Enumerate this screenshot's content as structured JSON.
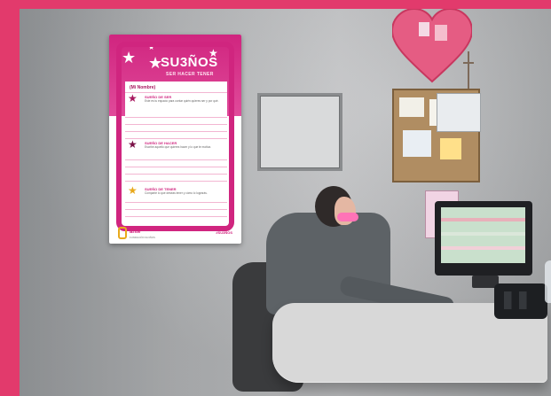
{
  "poster": {
    "title": "SU3ÑOS",
    "subtitle": "SER HACER TENER",
    "label": "(Mi Nombre)",
    "sections": [
      {
        "title": "SUEÑO DE SER",
        "text": "Este es tu espacio para contar quién quieres ser y por qué."
      },
      {
        "title": "SUEÑO DE HACER",
        "text": "Escribe aquello que quieres hacer y lo que te motiva."
      },
      {
        "title": "SUEÑO DE TENER",
        "text": "Comparte lo que deseas tener y cómo lo lograrás."
      }
    ],
    "footer": {
      "brand": "ante",
      "small": "FUNDACIÓN SU3ÑOS",
      "right": "#SU3ÑOS"
    }
  },
  "colors": {
    "frame": "#e23a6c",
    "poster_magenta": "#d0257f",
    "accent_yellow": "#e8a91d"
  },
  "icons": [
    "star-icon",
    "mini-star-icon",
    "badge-icon"
  ]
}
